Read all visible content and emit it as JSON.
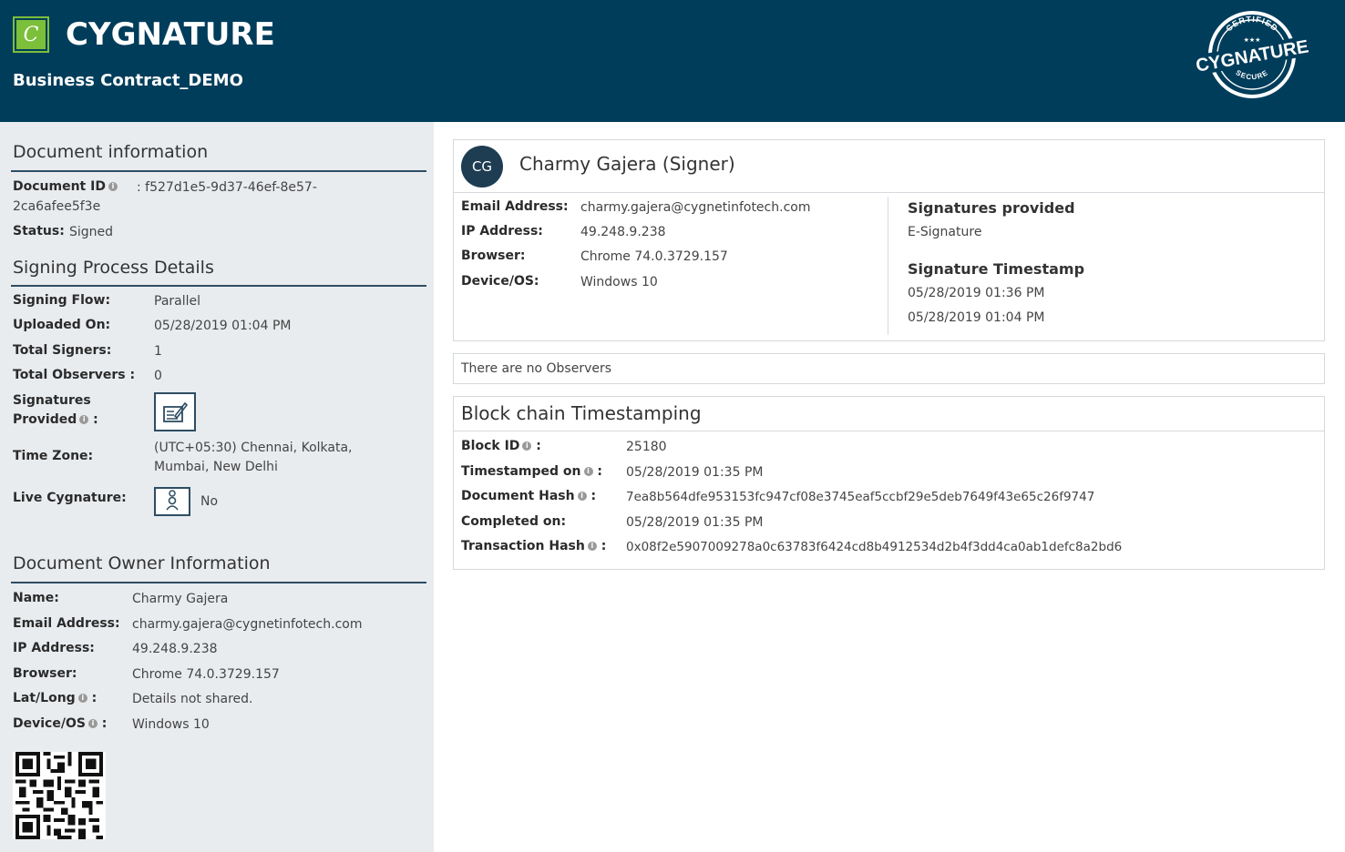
{
  "header": {
    "brand": "CYGNATURE",
    "logo_letter": "C",
    "document_name": "Business Contract_DEMO",
    "seal_top_text": "CERTIFIED",
    "seal_center_text": "CYGNATURE",
    "seal_bottom_text": "SECURE",
    "seal_stars": "★★★"
  },
  "document_information": {
    "title": "Document information",
    "document_id_label": "Document ID",
    "document_id_value_line1": ": f527d1e5-9d37-46ef-8e57-",
    "document_id_value_line2": "2ca6afee5f3e",
    "status_label": "Status:",
    "status_value": "Signed"
  },
  "signing_process": {
    "title": "Signing Process Details",
    "signing_flow_label": "Signing Flow:",
    "signing_flow_value": "Parallel",
    "uploaded_on_label": "Uploaded On:",
    "uploaded_on_value": "05/28/2019 01:04 PM",
    "total_signers_label": "Total Signers:",
    "total_signers_value": "1",
    "total_observers_label": "Total Observers :",
    "total_observers_value": "0",
    "signatures_provided_label_1": "Signatures",
    "signatures_provided_label_2": "Provided",
    "colon": ":",
    "time_zone_label": "Time Zone:",
    "time_zone_value_line1": "(UTC+05:30) Chennai, Kolkata,",
    "time_zone_value_line2": "Mumbai, New Delhi",
    "live_cygnature_label": "Live Cygnature:",
    "live_cygnature_value": "No"
  },
  "owner_information": {
    "title": "Document Owner Information",
    "name_label": "Name:",
    "name_value": "Charmy Gajera",
    "email_label": "Email Address:",
    "email_value": "charmy.gajera@cygnetinfotech.com",
    "ip_label": "IP Address:",
    "ip_value": "49.248.9.238",
    "browser_label": "Browser:",
    "browser_value": "Chrome 74.0.3729.157",
    "latlong_label": "Lat/Long",
    "latlong_value": "Details not shared.",
    "device_label": "Device/OS",
    "device_value": "Windows 10"
  },
  "signer_card": {
    "initials": "CG",
    "name": "Charmy Gajera (Signer)",
    "email_label": "Email Address:",
    "email_value": "charmy.gajera@cygnetinfotech.com",
    "ip_label": "IP Address:",
    "ip_value": "49.248.9.238",
    "browser_label": "Browser:",
    "browser_value": "Chrome 74.0.3729.157",
    "device_label": "Device/OS:",
    "device_value": "Windows 10",
    "signatures_provided_title": "Signatures provided",
    "signatures_provided_value": "E-Signature",
    "signature_timestamp_title": "Signature Timestamp",
    "timestamp_1": "05/28/2019 01:36 PM",
    "timestamp_2": "05/28/2019 01:04 PM"
  },
  "observers": {
    "text": "There are no Observers"
  },
  "blockchain": {
    "title": "Block chain Timestamping",
    "block_id_label": "Block ID",
    "block_id_value": "25180",
    "timestamped_on_label": "Timestamped on",
    "timestamped_on_value": "05/28/2019 01:35 PM",
    "document_hash_label": "Document Hash",
    "document_hash_value": "7ea8b564dfe953153fc947cf08e3745eaf5ccbf29e5deb7649f43e65c26f9747",
    "completed_on_label": "Completed on:",
    "completed_on_value": "05/28/2019 01:35 PM",
    "transaction_hash_label": "Transaction Hash",
    "transaction_hash_value": "0x08f2e5907009278a0c63783f6424cd8b4912534d2b4f3dd4ca0ab1defc8a2bd6",
    "colon": ":"
  },
  "colors": {
    "header_bg": "#003d5b",
    "accent_green": "#7cbf3a",
    "panel_bg": "#e9ecef",
    "avatar_bg": "#1e3d52"
  }
}
